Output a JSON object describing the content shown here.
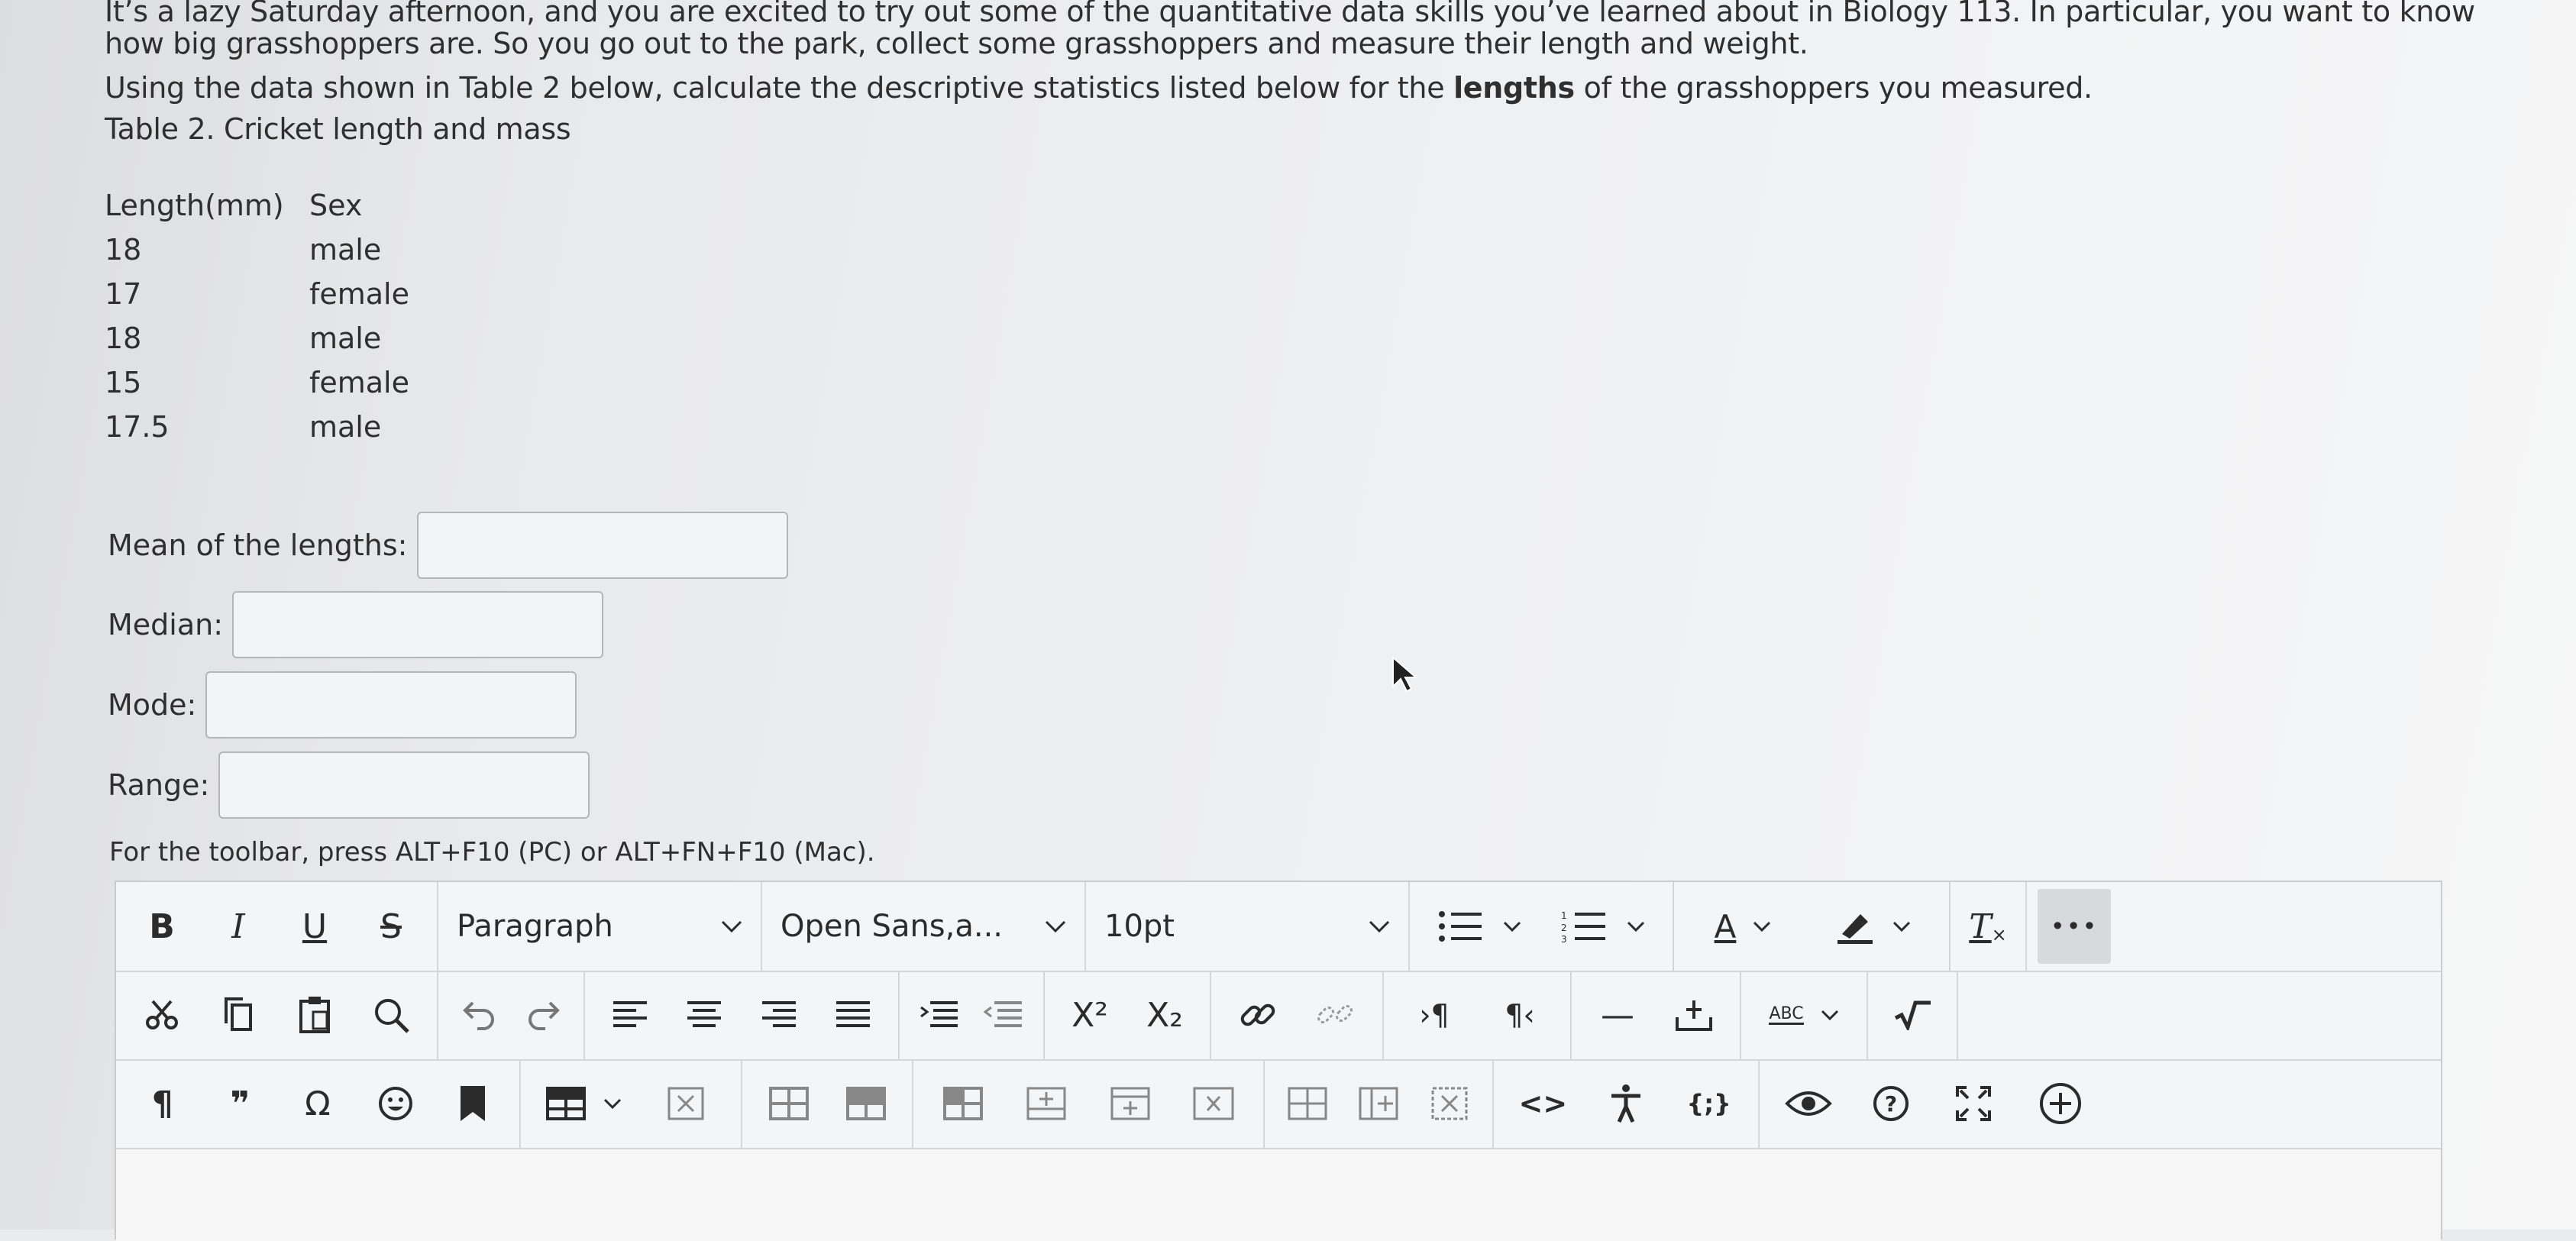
{
  "intro": {
    "p1": "It’s a lazy Saturday afternoon, and you are excited to try out some of the quantitative data skills you’ve learned about in Biology 113. In particular, you want to know how big grasshoppers are. So you go out to the park, collect some grasshoppers and measure their length and weight.",
    "p2_before": "Using the data shown in Table 2 below, calculate the descriptive statistics listed below for the ",
    "p2_bold": "lengths",
    "p2_after": " of the grasshoppers you measured.",
    "table_caption": "Table 2. Cricket length and mass"
  },
  "table": {
    "headers": [
      "Length(mm)",
      "Sex"
    ],
    "rows": [
      [
        "18",
        "male"
      ],
      [
        "17",
        "female"
      ],
      [
        "18",
        "male"
      ],
      [
        "15",
        "female"
      ],
      [
        "17.5",
        "male"
      ]
    ]
  },
  "fields": {
    "mean_label": "Mean of the lengths:",
    "mean_value": "",
    "median_label": "Median:",
    "median_value": "",
    "mode_label": "Mode:",
    "mode_value": "",
    "range_label": "Range:",
    "range_value": ""
  },
  "toolbar_hint": "For the toolbar, press ALT+F10 (PC) or ALT+FN+F10 (Mac).",
  "toolbar": {
    "bold": "B",
    "italic": "I",
    "underline": "U",
    "strike": "S",
    "block_format": "Paragraph",
    "font_family": "Open Sans,a...",
    "font_size": "10pt",
    "superscript": "X²",
    "subscript": "X₂",
    "text_color_letter": "A",
    "clear_format_letter": "T",
    "pilcrow": "¶",
    "ltr": "›¶",
    "rtl": "¶‹",
    "quote": "❞",
    "omega": "Ω",
    "code": "<>",
    "source": "{;}",
    "spell": "ABC",
    "hr": "—",
    "more": "•••"
  },
  "colors": {
    "border": "#c9ccd0",
    "separator": "#d4d6d9",
    "text": "#2b2b2b"
  }
}
